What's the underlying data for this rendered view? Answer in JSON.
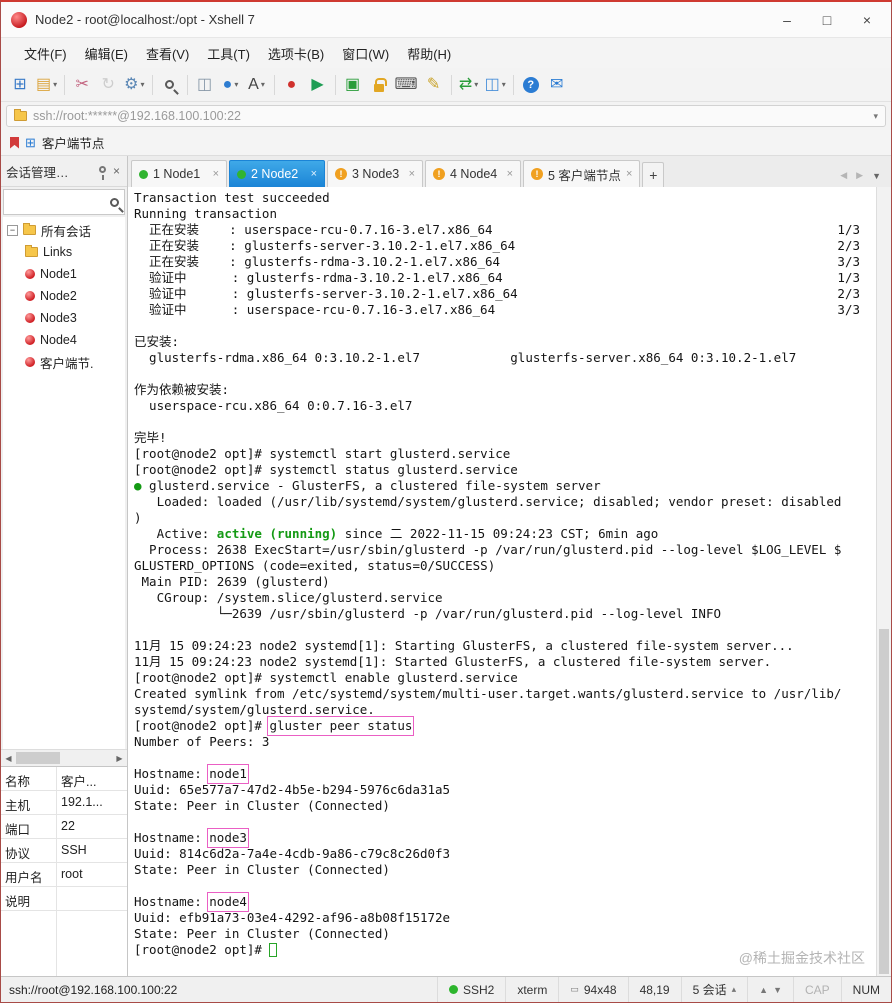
{
  "window": {
    "title": "Node2 - root@localhost:/opt - Xshell 7",
    "controls": {
      "minimize": "–",
      "maximize": "□",
      "close": "×"
    }
  },
  "menu": {
    "items": [
      "文件(F)",
      "编辑(E)",
      "查看(V)",
      "工具(T)",
      "选项卡(B)",
      "窗口(W)",
      "帮助(H)"
    ]
  },
  "toolbar": {
    "icons": [
      {
        "name": "new-session-icon",
        "glyph": "⊞",
        "color": "#3a7bc8"
      },
      {
        "name": "open-session-icon",
        "glyph": "▤",
        "color": "#dba43c",
        "dropdown": true
      },
      {
        "sep": true
      },
      {
        "name": "disconnect-icon",
        "glyph": "✂",
        "color": "#c2627e"
      },
      {
        "name": "reconnect-icon",
        "glyph": "↻",
        "color": "#888888",
        "disabled": true
      },
      {
        "name": "session-properties-icon",
        "glyph": "⚙",
        "color": "#5b87b5",
        "dropdown": true
      },
      {
        "sep": true
      },
      {
        "name": "find-icon",
        "shape": "mag"
      },
      {
        "sep": true
      },
      {
        "name": "duplicate-session-icon",
        "glyph": "◫",
        "color": "#8898a8"
      },
      {
        "name": "globe-icon",
        "glyph": "●",
        "color": "#2e7dd1",
        "dropdown": true
      },
      {
        "name": "font-icon",
        "glyph": "A",
        "color": "#444444",
        "dropdown": true
      },
      {
        "sep": true
      },
      {
        "name": "record-icon",
        "glyph": "●",
        "color": "#d0312d"
      },
      {
        "name": "run-script-icon",
        "glyph": "▶",
        "color": "#1f9d55"
      },
      {
        "sep": true
      },
      {
        "name": "fullscreen-icon",
        "glyph": "▣",
        "color": "#2a9d3a"
      },
      {
        "name": "lock-icon",
        "shape": "lock"
      },
      {
        "name": "keyboard-icon",
        "glyph": "⌨",
        "color": "#555555"
      },
      {
        "name": "highlighter-icon",
        "glyph": "✎",
        "color": "#c9a227"
      },
      {
        "sep": true
      },
      {
        "name": "file-transfer-icon",
        "glyph": "⇄",
        "color": "#2a9d3a",
        "dropdown": true
      },
      {
        "name": "layout-icon",
        "glyph": "◫",
        "color": "#4a90d9",
        "dropdown": true
      },
      {
        "sep": true
      },
      {
        "name": "help-icon",
        "shape": "help"
      },
      {
        "name": "feedback-icon",
        "glyph": "✉",
        "color": "#2b7cd3"
      }
    ]
  },
  "address_bar": {
    "value": "ssh://root:******@192.168.100.100:22",
    "dropdown": "▾"
  },
  "bookmark_bar": {
    "label": "客户端节点",
    "window_glyph": "⊞"
  },
  "tabs": {
    "items": [
      {
        "label": "1 Node1",
        "icon": "green"
      },
      {
        "label": "2 Node2",
        "icon": "green",
        "active": true
      },
      {
        "label": "3 Node3",
        "icon": "alert"
      },
      {
        "label": "4 Node4",
        "icon": "alert"
      },
      {
        "label": "5 客户端节点",
        "icon": "alert"
      }
    ],
    "add": "+",
    "prev": "◀",
    "next": "▶",
    "list": "▼",
    "alert_glyph": "!"
  },
  "session_panel": {
    "title": "会话管理…",
    "close": "×",
    "root": "所有会话",
    "collapse_glyph": "−",
    "items": [
      {
        "label": "Links",
        "icon": "folder"
      },
      {
        "label": "Node1",
        "icon": "session"
      },
      {
        "label": "Node2",
        "icon": "session"
      },
      {
        "label": "Node3",
        "icon": "session"
      },
      {
        "label": "Node4",
        "icon": "session"
      },
      {
        "label": "客户端节.",
        "icon": "session"
      }
    ],
    "hscroll_left": "◀",
    "hscroll_right": "▶"
  },
  "properties": {
    "rows": [
      {
        "key": "名称",
        "value": "客户..."
      },
      {
        "key": "主机",
        "value": "192.1..."
      },
      {
        "key": "端口",
        "value": "22"
      },
      {
        "key": "协议",
        "value": "SSH"
      },
      {
        "key": "用户名",
        "value": "root"
      },
      {
        "key": "说明",
        "value": ""
      }
    ]
  },
  "terminal": {
    "lines": [
      [
        {
          "t": "Transaction test succeeded"
        }
      ],
      [
        {
          "t": "Running transaction"
        }
      ],
      [
        {
          "t": "  正在安装    : userspace-rcu-0.7.16-3.el7.x86_64"
        },
        {
          "c": "f"
        },
        {
          "t": "1/3"
        }
      ],
      [
        {
          "t": "  正在安装    : glusterfs-server-3.10.2-1.el7.x86_64"
        },
        {
          "c": "f"
        },
        {
          "t": "2/3"
        }
      ],
      [
        {
          "t": "  正在安装    : glusterfs-rdma-3.10.2-1.el7.x86_64"
        },
        {
          "c": "f"
        },
        {
          "t": "3/3"
        }
      ],
      [
        {
          "t": "  验证中      : glusterfs-rdma-3.10.2-1.el7.x86_64"
        },
        {
          "c": "f"
        },
        {
          "t": "1/3"
        }
      ],
      [
        {
          "t": "  验证中      : glusterfs-server-3.10.2-1.el7.x86_64"
        },
        {
          "c": "f"
        },
        {
          "t": "2/3"
        }
      ],
      [
        {
          "t": "  验证中      : userspace-rcu-0.7.16-3.el7.x86_64"
        },
        {
          "c": "f"
        },
        {
          "t": "3/3"
        }
      ],
      [],
      [
        {
          "t": "已安装:"
        }
      ],
      [
        {
          "t": "  glusterfs-rdma.x86_64 0:3.10.2-1.el7            glusterfs-server.x86_64 0:3.10.2-1.el7"
        }
      ],
      [],
      [
        {
          "t": "作为依赖被安装:"
        }
      ],
      [
        {
          "t": "  userspace-rcu.x86_64 0:0.7.16-3.el7"
        }
      ],
      [],
      [
        {
          "t": "完毕!"
        }
      ],
      [
        {
          "t": "[root@node2 opt]# systemctl start glusterd.service"
        }
      ],
      [
        {
          "t": "[root@node2 opt]# systemctl status glusterd.service"
        }
      ],
      [
        {
          "t": "●",
          "c": "g"
        },
        {
          "t": " glusterd.service - GlusterFS, a clustered file-system server"
        }
      ],
      [
        {
          "t": "   Loaded: loaded (/usr/lib/systemd/system/glusterd.service; disabled; vendor preset: disabled"
        }
      ],
      [
        {
          "t": ")"
        }
      ],
      [
        {
          "t": "   Active: "
        },
        {
          "t": "active (running)",
          "c": "g"
        },
        {
          "t": " since 二 2022-11-15 09:24:23 CST; 6min ago"
        }
      ],
      [
        {
          "t": "  Process: 2638 ExecStart=/usr/sbin/glusterd -p /var/run/glusterd.pid --log-level $LOG_LEVEL $"
        }
      ],
      [
        {
          "t": "GLUSTERD_OPTIONS (code=exited, status=0/SUCCESS)"
        }
      ],
      [
        {
          "t": " Main PID: 2639 (glusterd)"
        }
      ],
      [
        {
          "t": "   CGroup: /system.slice/glusterd.service"
        }
      ],
      [
        {
          "t": "           └─2639 /usr/sbin/glusterd -p /var/run/glusterd.pid --log-level INFO"
        }
      ],
      [],
      [
        {
          "t": "11月 15 09:24:23 node2 systemd[1]: Starting GlusterFS, a clustered file-system server..."
        }
      ],
      [
        {
          "t": "11月 15 09:24:23 node2 systemd[1]: Started GlusterFS, a clustered file-system server."
        }
      ],
      [
        {
          "t": "[root@node2 opt]# systemctl enable glusterd.service"
        }
      ],
      [
        {
          "t": "Created symlink from /etc/systemd/system/multi-user.target.wants/glusterd.service to /usr/lib/"
        }
      ],
      [
        {
          "t": "systemd/system/glusterd.service."
        }
      ],
      [
        {
          "t": "[root@node2 opt]# "
        },
        {
          "t": "gluster peer status",
          "c": "b"
        }
      ],
      [
        {
          "t": "Number of Peers: 3"
        }
      ],
      [],
      [
        {
          "t": "Hostname: "
        },
        {
          "t": "node1",
          "c": "b"
        }
      ],
      [
        {
          "t": "Uuid: 65e577a7-47d2-4b5e-b294-5976c6da31a5"
        }
      ],
      [
        {
          "t": "State: Peer in Cluster (Connected)"
        }
      ],
      [],
      [
        {
          "t": "Hostname: "
        },
        {
          "t": "node3",
          "c": "b"
        }
      ],
      [
        {
          "t": "Uuid: 814c6d2a-7a4e-4cdb-9a86-c79c8c26d0f3"
        }
      ],
      [
        {
          "t": "State: Peer in Cluster (Connected)"
        }
      ],
      [],
      [
        {
          "t": "Hostname: "
        },
        {
          "t": "node4",
          "c": "b"
        }
      ],
      [
        {
          "t": "Uuid: efb91a73-03e4-4292-af96-a8b08f15172e"
        }
      ],
      [
        {
          "t": "State: Peer in Cluster (Connected)"
        }
      ],
      [
        {
          "t": "[root@node2 opt]# "
        },
        {
          "c": "cur"
        }
      ]
    ]
  },
  "watermark": "@稀土掘金技术社区",
  "status_bar": {
    "url": "ssh://root@192.168.100.100:22",
    "protocol": "SSH2",
    "terminal_type": "xterm",
    "size_glyph": "▭",
    "size": "94x48",
    "cursor_pos": "48,19",
    "sessions": "5 会话",
    "sessions_arrow": "▴",
    "up": "▲",
    "down": "▼",
    "cap": "CAP",
    "num": "NUM"
  }
}
